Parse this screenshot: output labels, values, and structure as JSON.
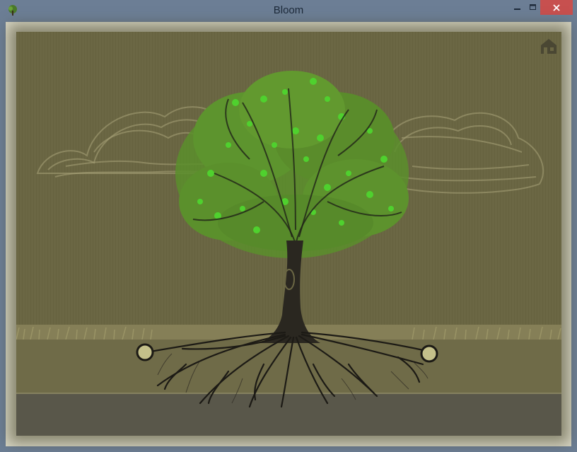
{
  "window": {
    "title": "Bloom",
    "controls": {
      "minimize_icon": "minimize-icon",
      "maximize_icon": "maximize-icon",
      "close_icon": "close-icon"
    },
    "app_icon": "tree-icon"
  },
  "scene": {
    "home_icon": "home-icon",
    "colors": {
      "sky": "#6b6744",
      "soil": "#6f6b48",
      "bedrock": "#59574a",
      "grass": "#9a9466",
      "cloud": "#a9a47a",
      "canopy_dark": "#5b8f2c",
      "canopy_light": "#4fd12e",
      "trunk": "#2a2720",
      "root_node": "#c4c08a"
    }
  }
}
